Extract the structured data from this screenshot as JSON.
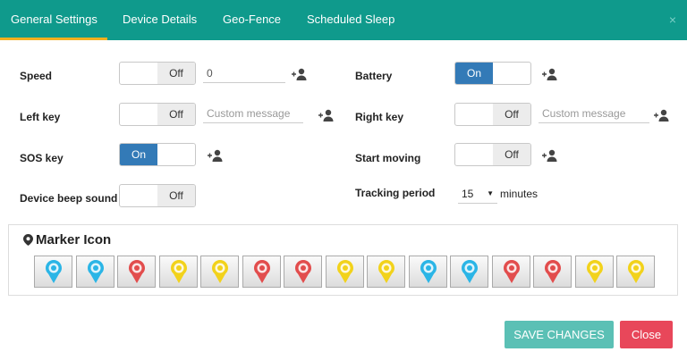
{
  "tabs": [
    {
      "label": "General Settings"
    },
    {
      "label": "Device Details"
    },
    {
      "label": "Geo-Fence"
    },
    {
      "label": "Scheduled Sleep"
    }
  ],
  "close_x": "×",
  "left_rows": {
    "speed": {
      "label": "Speed",
      "toggle": "Off",
      "value": "0"
    },
    "left_key": {
      "label": "Left key",
      "toggle": "Off",
      "placeholder": "Custom message"
    },
    "sos_key": {
      "label": "SOS key",
      "toggle": "On"
    },
    "beep": {
      "label": "Device beep sound",
      "toggle": "Off"
    }
  },
  "right_rows": {
    "battery": {
      "label": "Battery",
      "toggle": "On"
    },
    "right_key": {
      "label": "Right key",
      "toggle": "Off",
      "placeholder": "Custom message"
    },
    "start_moving": {
      "label": "Start moving",
      "toggle": "Off"
    },
    "tracking": {
      "label": "Tracking period",
      "value": "15",
      "unit": "minutes"
    }
  },
  "marker": {
    "title": "Marker Icon",
    "icons": [
      {
        "name": "globe",
        "color": "#2bb5e6"
      },
      {
        "name": "minus",
        "color": "#2bb5e6"
      },
      {
        "name": "cloud",
        "color": "#e24d4d"
      },
      {
        "name": "target",
        "color": "#f2d21b"
      },
      {
        "name": "eye",
        "color": "#f2d21b"
      },
      {
        "name": "shield",
        "color": "#e24d4d"
      },
      {
        "name": "car",
        "color": "#e24d4d"
      },
      {
        "name": "key",
        "color": "#f2d21b"
      },
      {
        "name": "bulb",
        "color": "#f2d21b"
      },
      {
        "name": "star",
        "color": "#2bb5e6"
      },
      {
        "name": "pencil",
        "color": "#2bb5e6"
      },
      {
        "name": "compass",
        "color": "#e24d4d"
      },
      {
        "name": "flower",
        "color": "#e24d4d"
      },
      {
        "name": "walker",
        "color": "#f2d21b"
      },
      {
        "name": "chat",
        "color": "#f2d21b"
      }
    ]
  },
  "footer": {
    "save": "SAVE CHANGES",
    "close": "Close"
  },
  "colors": {
    "header": "#0f9a8c",
    "tab_active": "#f2b01e",
    "toggle_on": "#337ab7",
    "save": "#5bc0b5",
    "close": "#e8475a"
  }
}
